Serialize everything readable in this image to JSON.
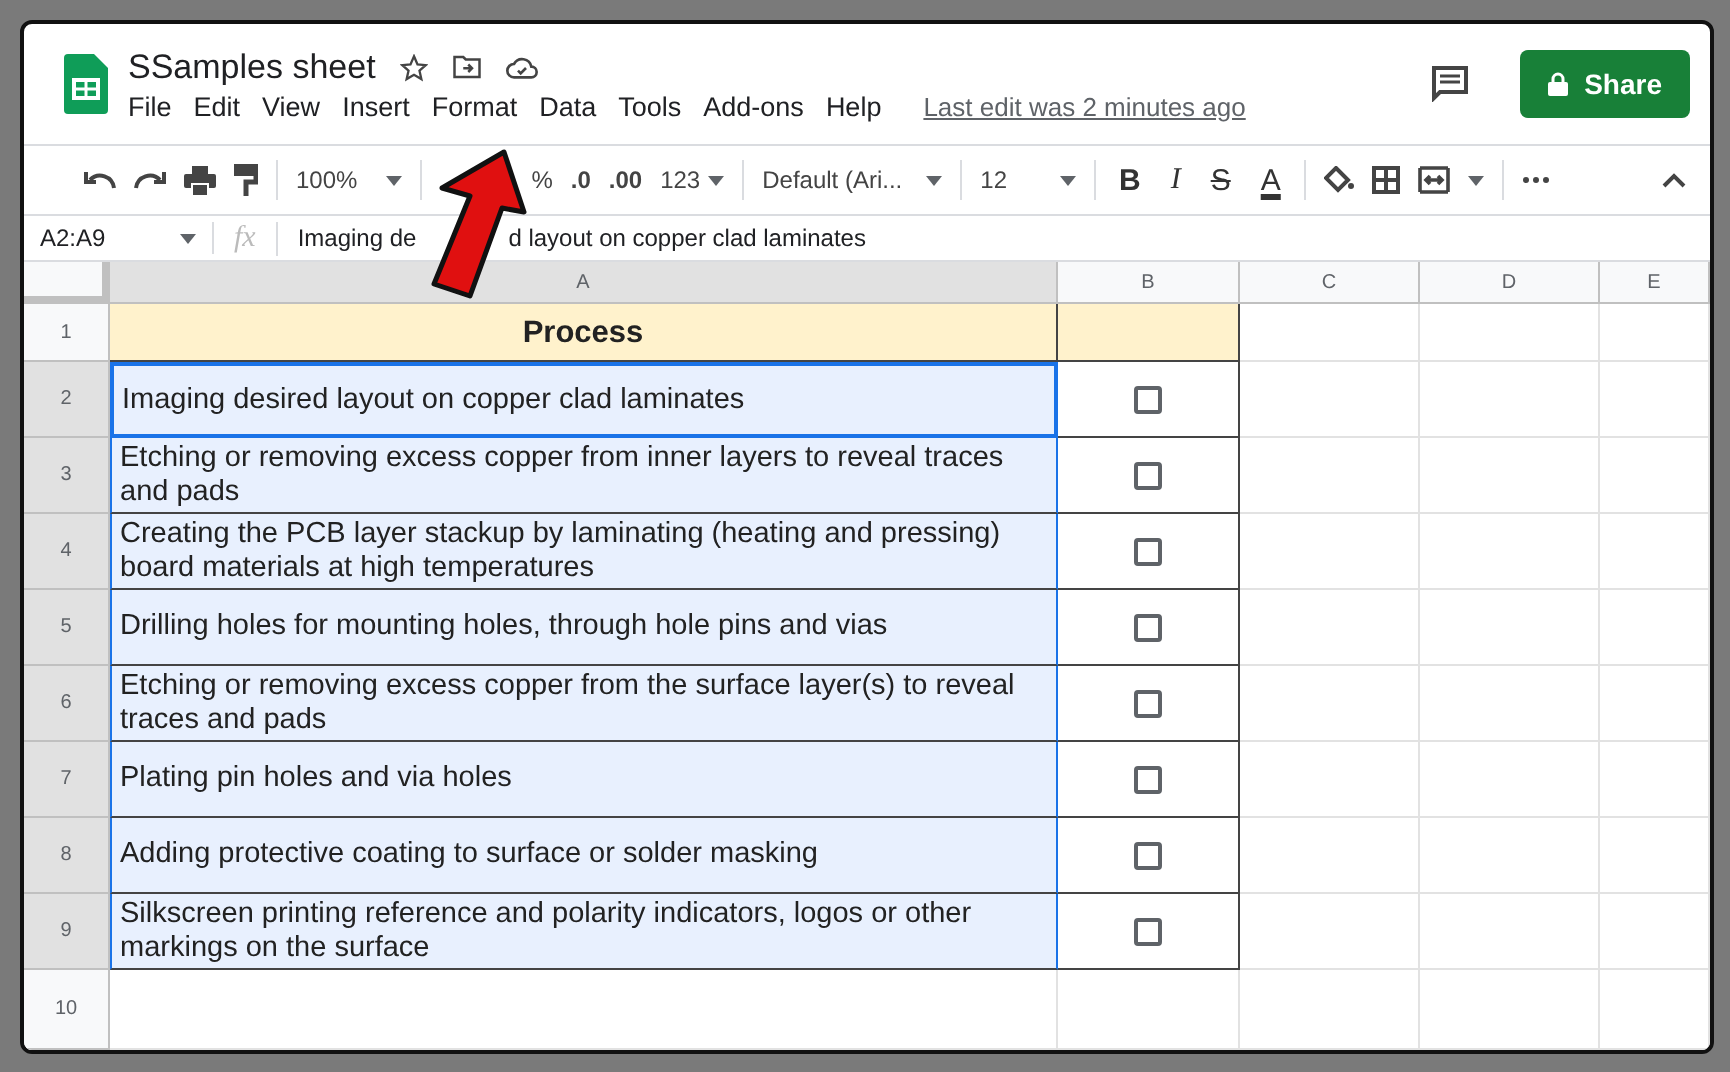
{
  "document": {
    "title": "SSamples sheet",
    "menu": [
      "File",
      "Edit",
      "View",
      "Insert",
      "Format",
      "Data",
      "Tools",
      "Add-ons",
      "Help"
    ],
    "last_edit": "Last edit was 2 minutes ago",
    "share_label": "Share"
  },
  "toolbar": {
    "zoom": "100%",
    "percent": "%",
    "decimal_decrease": ".0",
    "decimal_increase": ".00",
    "number_format": "123",
    "font": "Default (Ari...",
    "font_size": "12",
    "text_format": [
      {
        "kind": "bold",
        "label": "B"
      },
      {
        "kind": "italic",
        "label": "I"
      },
      {
        "kind": "strike",
        "label": "S"
      },
      {
        "kind": "color",
        "label": "A"
      }
    ]
  },
  "formula_bar": {
    "name_box": "A2:A9",
    "fx": "fx",
    "formula_parts": [
      "Imaging de",
      "d layout on copper clad laminates"
    ]
  },
  "columns": [
    "A",
    "B",
    "C",
    "D",
    "E"
  ],
  "rows": [
    {
      "number": "1",
      "kind": "header",
      "text": "Process",
      "selected": false
    },
    {
      "number": "2",
      "kind": "task",
      "text": "Imaging desired layout on copper clad laminates",
      "checked": false,
      "selected": true
    },
    {
      "number": "3",
      "kind": "task",
      "text": "Etching or removing excess copper from inner layers to reveal traces and pads",
      "checked": false,
      "selected": true
    },
    {
      "number": "4",
      "kind": "task",
      "text": "Creating the PCB layer stackup by laminating (heating and pressing) board materials at high temperatures",
      "checked": false,
      "selected": true
    },
    {
      "number": "5",
      "kind": "task",
      "text": "Drilling holes for mounting holes, through hole pins and vias",
      "checked": false,
      "selected": true
    },
    {
      "number": "6",
      "kind": "task",
      "text": "Etching or removing excess copper from the surface layer(s) to reveal traces and pads",
      "checked": false,
      "selected": true
    },
    {
      "number": "7",
      "kind": "task",
      "text": "Plating pin holes and via holes",
      "checked": false,
      "selected": true
    },
    {
      "number": "8",
      "kind": "task",
      "text": "Adding protective coating to surface or solder masking",
      "checked": false,
      "selected": true
    },
    {
      "number": "9",
      "kind": "task",
      "text": "Silkscreen printing reference and polarity indicators, logos or other markings on the surface",
      "checked": false,
      "selected": true
    },
    {
      "number": "10",
      "kind": "blank",
      "selected": false
    }
  ]
}
